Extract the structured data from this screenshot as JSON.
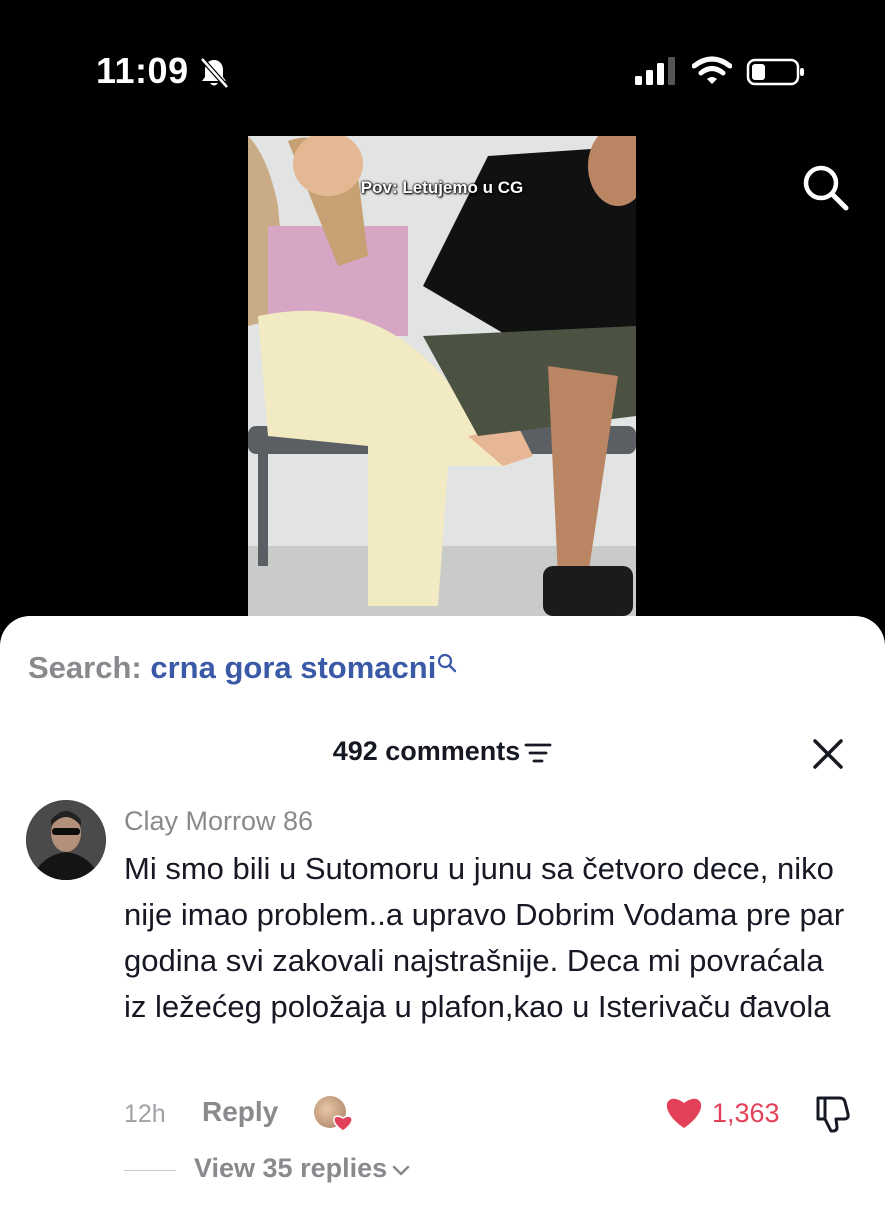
{
  "status_bar": {
    "time": "11:09",
    "icons": [
      "bell-slash-icon",
      "signal-icon",
      "wifi-icon",
      "battery-icon"
    ]
  },
  "video": {
    "caption": "Pov: Letujemo u CG"
  },
  "sheet": {
    "search": {
      "prefix": "Search:",
      "term": "crna gora stomacni"
    },
    "comments_count_label": "492 comments"
  },
  "comment": {
    "username": "Clay Morrow 86",
    "text": "Mi smo bili u Sutomoru u junu sa četvoro dece, niko nije imao problem..a upravo Dobrim Vodama pre par godina svi zakovali najstrašnije. Deca mi povraćala iz ležećeg položaja u plafon,kao u Isterivaču đavola",
    "time": "12h",
    "reply_label": "Reply",
    "likes": "1,363",
    "view_replies_label": "View 35 replies"
  },
  "colors": {
    "accent_blue": "#3a5aa8",
    "like_red": "#e3415a",
    "muted_gray": "#8a8a8e"
  }
}
